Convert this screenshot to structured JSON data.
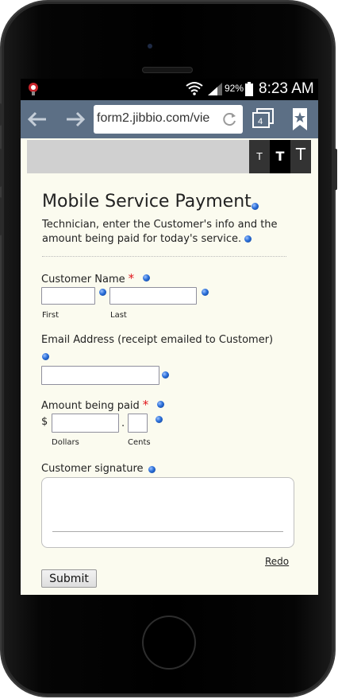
{
  "status_bar": {
    "battery_percent": "92%",
    "time": "8:23 AM",
    "icons": [
      "app-notification-icon",
      "wifi-icon",
      "signal-icon",
      "battery-icon"
    ]
  },
  "browser": {
    "url": "form2.jibbio.com/vie",
    "tab_count": "4",
    "icons": [
      "back-arrow-icon",
      "forward-arrow-icon",
      "reload-icon",
      "tabs-icon",
      "bookmark-icon"
    ]
  },
  "text_size_buttons": [
    "T",
    "T",
    "T"
  ],
  "form": {
    "title": "Mobile Service Payment",
    "description": "Technician, enter the Customer's info and the amount being paid for today's service.",
    "customer_name": {
      "label": "Customer Name",
      "required_mark": "*",
      "first_label": "First",
      "last_label": "Last",
      "first_value": "",
      "last_value": ""
    },
    "email": {
      "label": "Email Address (receipt emailed to Customer)",
      "value": ""
    },
    "amount": {
      "label": "Amount being paid",
      "required_mark": "*",
      "currency_symbol": "$",
      "decimal_separator": ".",
      "dollars_label": "Dollars",
      "cents_label": "Cents",
      "dollars_value": "",
      "cents_value": ""
    },
    "signature": {
      "label": "Customer signature",
      "redo_label": "Redo"
    },
    "submit_label": "Submit"
  },
  "colors": {
    "form_background": "#fbfbef",
    "browser_bar": "#5c6f85",
    "required_star": "#e0161c",
    "help_icon": "#2a6ed8"
  }
}
